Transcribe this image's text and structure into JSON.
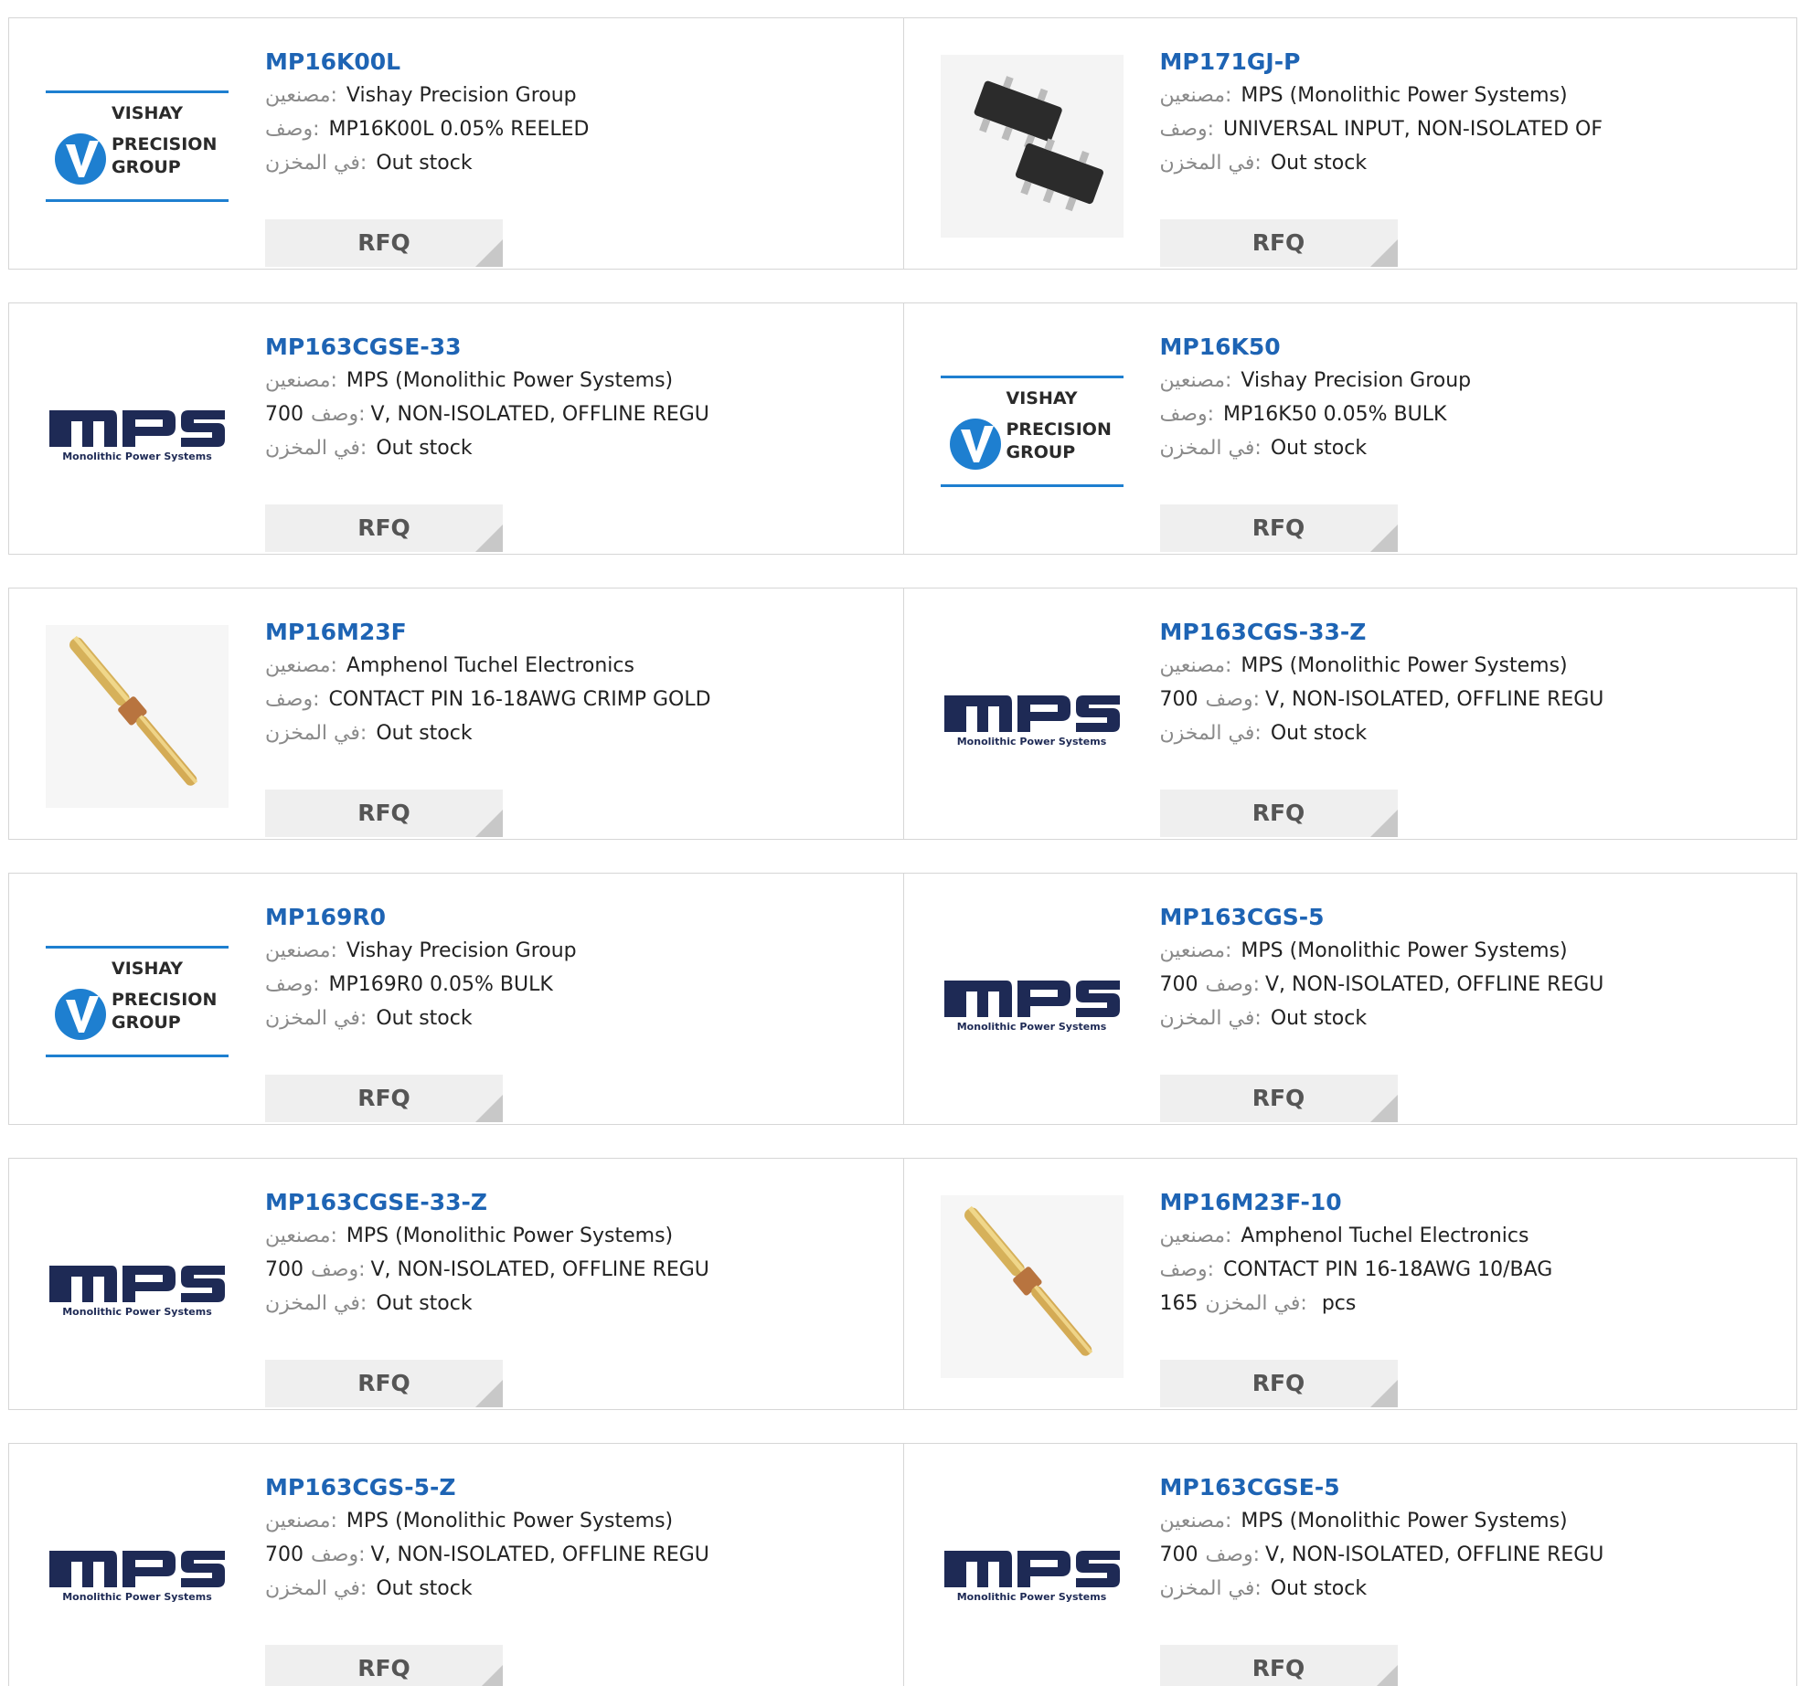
{
  "labels": {
    "manufacturer": "مصنعين:",
    "description": "وصف:",
    "stock": "في المخزن:",
    "rfq": "RFQ"
  },
  "products": [
    {
      "pn": "MP16K00L",
      "logo": "vishay",
      "manufacturer": "Vishay Precision Group",
      "description": "MP16K00L 0.05% REELED",
      "stock": "Out stock"
    },
    {
      "pn": "MP171GJ-P",
      "logo": "ic-chip",
      "manufacturer": "MPS (Monolithic Power Systems)",
      "description": "UNIVERSAL INPUT, NON-ISOLATED OF",
      "stock": "Out stock"
    },
    {
      "pn": "MP163CGSE-33",
      "logo": "mps",
      "manufacturer": "MPS (Monolithic Power Systems)",
      "description_prefix": "700",
      "description_label": "وصف:",
      "description": "V, NON-ISOLATED, OFFLINE REGU",
      "stock": "Out stock"
    },
    {
      "pn": "MP16K50",
      "logo": "vishay",
      "manufacturer": "Vishay Precision Group",
      "description": "MP16K50 0.05% BULK",
      "stock": "Out stock"
    },
    {
      "pn": "MP16M23F",
      "logo": "contact-pin",
      "manufacturer": "Amphenol Tuchel Electronics",
      "description": "CONTACT PIN 16-18AWG CRIMP GOLD",
      "stock": "Out stock"
    },
    {
      "pn": "MP163CGS-33-Z",
      "logo": "mps",
      "manufacturer": "MPS (Monolithic Power Systems)",
      "description_prefix": "700",
      "description": "V, NON-ISOLATED, OFFLINE REGU",
      "stock": "Out stock"
    },
    {
      "pn": "MP169R0",
      "logo": "vishay",
      "manufacturer": "Vishay Precision Group",
      "description": "MP169R0 0.05% BULK",
      "stock": "Out stock"
    },
    {
      "pn": "MP163CGS-5",
      "logo": "mps",
      "manufacturer": "MPS (Monolithic Power Systems)",
      "description_prefix": "700",
      "description": "V, NON-ISOLATED, OFFLINE REGU",
      "stock": "Out stock"
    },
    {
      "pn": "MP163CGSE-33-Z",
      "logo": "mps",
      "manufacturer": "MPS (Monolithic Power Systems)",
      "description_prefix": "700",
      "description": "V, NON-ISOLATED, OFFLINE REGU",
      "stock": "Out stock"
    },
    {
      "pn": "MP16M23F-10",
      "logo": "contact-pin",
      "manufacturer": "Amphenol Tuchel Electronics",
      "description": "CONTACT PIN 16-18AWG 10/BAG",
      "stock_number": "165",
      "stock_unit": "pcs"
    },
    {
      "pn": "MP163CGS-5-Z",
      "logo": "mps",
      "manufacturer": "MPS (Monolithic Power Systems)",
      "description_prefix": "700",
      "description": "V, NON-ISOLATED, OFFLINE REGU",
      "stock": "Out stock"
    },
    {
      "pn": "MP163CGSE-5",
      "logo": "mps",
      "manufacturer": "MPS (Monolithic Power Systems)",
      "description_prefix": "700",
      "description": "V, NON-ISOLATED, OFFLINE REGU",
      "stock": "Out stock"
    }
  ],
  "logos": {
    "vishay": {
      "line1": "VISHAY",
      "line2": "PRECISION",
      "line3": "GROUP"
    },
    "mps": {
      "text": "MPS",
      "sub": "Monolithic Power Systems"
    }
  },
  "colors": {
    "part_number": "#1e64b4",
    "label": "#8a8a8a",
    "rfq_bg": "#efefef",
    "border": "#d6d6d6",
    "mps_navy": "#1e2a55",
    "vishay_blue": "#1e7fd0"
  }
}
